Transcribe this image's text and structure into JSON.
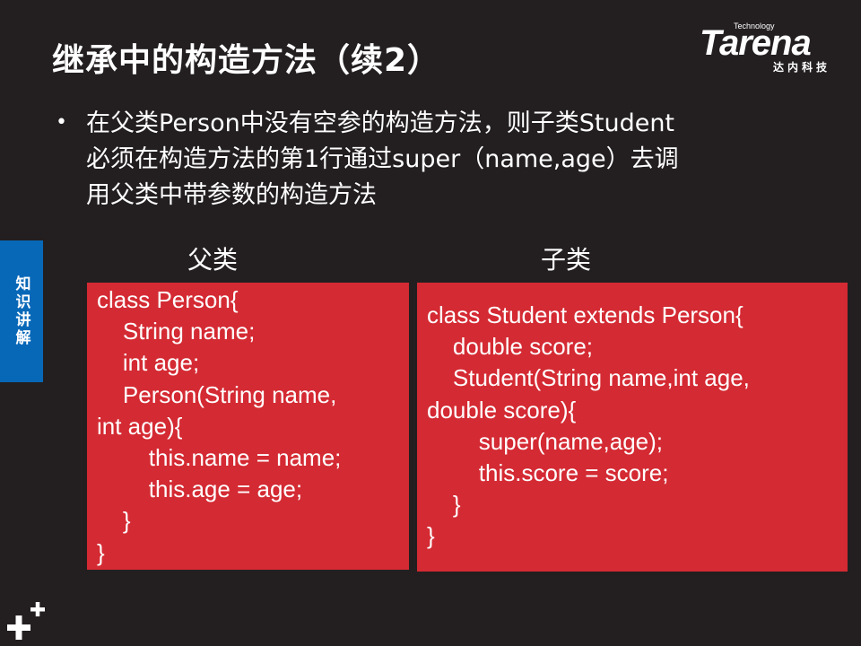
{
  "slide": {
    "title": "继承中的构造方法（续2）",
    "logo": {
      "tagline": "Technology",
      "wordmark": "Tarena",
      "subtitle": "达内科技"
    },
    "bullet": {
      "lines": [
        "在父类Person中没有空参的构造方法，则子类Student",
        "必须在构造方法的第1行通过super（name,age）去调",
        "用父类中带参数的构造方法"
      ]
    },
    "side_tab": "知识讲解",
    "columns": {
      "parent_label": "父类",
      "child_label": "子类"
    },
    "parent_code": [
      "class Person{",
      "    String name;",
      "    int age;",
      "    Person(String name,",
      "int age){",
      "        this.name = name;",
      "        this.age = age;",
      "    }",
      "}"
    ],
    "child_code": [
      "class Student extends Person{",
      "    double score;",
      "    Student(String name,int age,",
      "double score){",
      "        super(name,age);",
      "        this.score = score;",
      "    }",
      "}"
    ],
    "colors": {
      "background": "#231f20",
      "code_box": "#d42a33",
      "side_tab": "#0868b8",
      "text": "#ffffff"
    }
  }
}
